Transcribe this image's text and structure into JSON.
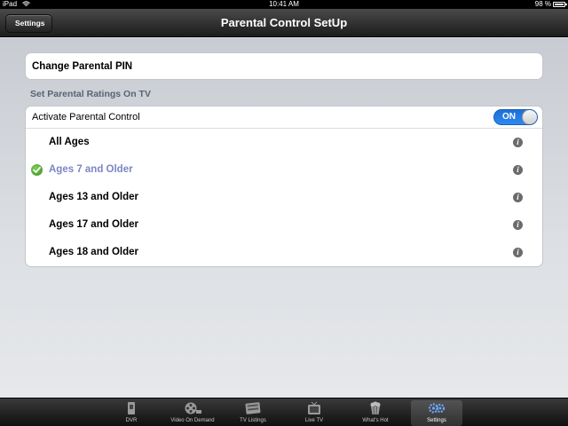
{
  "status_bar": {
    "device": "iPad",
    "time": "10:41 AM",
    "battery": "98 %"
  },
  "nav": {
    "back_label": "Settings",
    "title": "Parental Control SetUp"
  },
  "pin": {
    "label": "Change Parental PIN"
  },
  "ratings_section": {
    "header": "Set Parental Ratings On TV",
    "activate_label": "Activate Parental Control",
    "toggle_label": "ON",
    "toggle_on": true,
    "items": [
      {
        "label": "All Ages",
        "selected": false
      },
      {
        "label": "Ages 7 and Older",
        "selected": true
      },
      {
        "label": "Ages 13 and Older",
        "selected": false
      },
      {
        "label": "Ages 17 and Older",
        "selected": false
      },
      {
        "label": "Ages 18 and Older",
        "selected": false
      }
    ],
    "info_glyph": "i"
  },
  "tabbar": {
    "tabs": [
      {
        "label": "DVR",
        "icon": "dvr-icon",
        "active": false
      },
      {
        "label": "Video On Demand",
        "icon": "film-reel-icon",
        "active": false
      },
      {
        "label": "TV Listings",
        "icon": "tv-listings-icon",
        "active": false
      },
      {
        "label": "Live TV",
        "icon": "tv-icon",
        "active": false
      },
      {
        "label": "What's Hot",
        "icon": "popcorn-icon",
        "active": false
      },
      {
        "label": "Settings",
        "icon": "gears-icon",
        "active": true
      }
    ]
  },
  "colors": {
    "selected_text": "#7b86c4",
    "toggle_on": "#2d88f0",
    "check": "#3b8e24"
  }
}
